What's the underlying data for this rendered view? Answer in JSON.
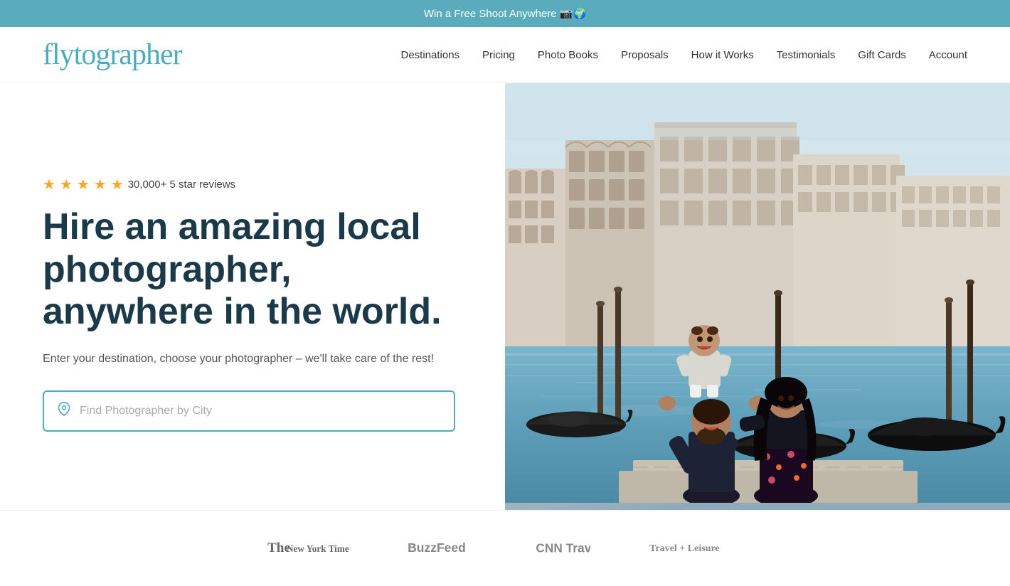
{
  "banner": {
    "text": "Win a Free Shoot Anywhere 📷🌍"
  },
  "logo": {
    "text": "flytographer"
  },
  "nav": {
    "items": [
      {
        "label": "Destinations",
        "href": "#"
      },
      {
        "label": "Pricing",
        "href": "#"
      },
      {
        "label": "Photo Books",
        "href": "#"
      },
      {
        "label": "Proposals",
        "href": "#"
      },
      {
        "label": "How it Works",
        "href": "#"
      },
      {
        "label": "Testimonials",
        "href": "#"
      },
      {
        "label": "Gift Cards",
        "href": "#"
      },
      {
        "label": "Account",
        "href": "#"
      }
    ]
  },
  "hero": {
    "stars_count": "5",
    "review_text": "30,000+ 5 star reviews",
    "title": "Hire an amazing local photographer, anywhere in the world.",
    "subtitle": "Enter your destination, choose your photographer – we'll take care of the rest!",
    "search_placeholder": "Find Photographer by City"
  },
  "press": {
    "logos": [
      {
        "name": "The New York Times",
        "style": "serif"
      },
      {
        "name": "BuzzFeed",
        "style": "normal"
      },
      {
        "name": "CNN Travel",
        "style": "normal"
      },
      {
        "name": "Travel + Leisure",
        "style": "serif"
      }
    ]
  },
  "colors": {
    "brand_teal": "#4aacbc",
    "banner_bg": "#5aabbb",
    "title_dark": "#1a3a4a",
    "star_yellow": "#f5a623"
  }
}
